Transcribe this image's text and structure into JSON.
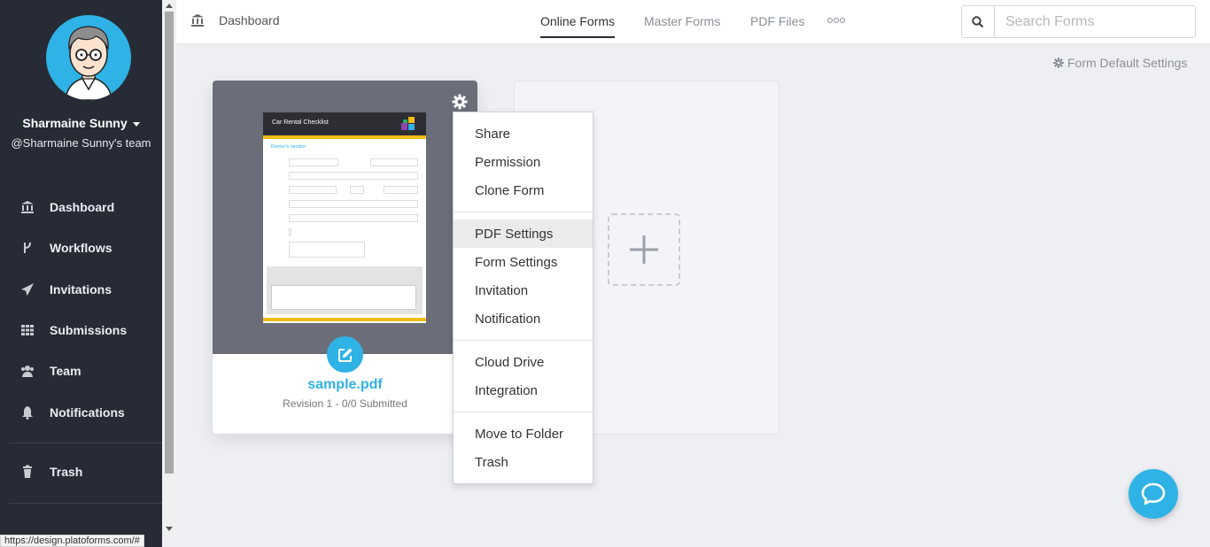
{
  "sidebar": {
    "user_name": "Sharmaine Sunny",
    "team": "@Sharmaine Sunny's team",
    "items": [
      {
        "label": "Dashboard",
        "icon": "bank-icon"
      },
      {
        "label": "Workflows",
        "icon": "branch-icon"
      },
      {
        "label": "Invitations",
        "icon": "paper-plane-icon"
      },
      {
        "label": "Submissions",
        "icon": "grid-icon"
      },
      {
        "label": "Team",
        "icon": "users-icon"
      },
      {
        "label": "Notifications",
        "icon": "bell-icon"
      },
      {
        "label": "Trash",
        "icon": "trash-icon"
      }
    ]
  },
  "status_url": "https://design.platoforms.com/#",
  "header": {
    "breadcrumb": "Dashboard",
    "tabs": [
      {
        "label": "Online Forms",
        "active": true
      },
      {
        "label": "Master Forms",
        "active": false
      },
      {
        "label": "PDF Files",
        "active": false
      }
    ],
    "search": {
      "placeholder": "Search Forms",
      "value": ""
    }
  },
  "form_default_settings": "Form Default Settings",
  "card": {
    "title": "sample.pdf",
    "meta": "Revision 1 - 0/0 Submitted",
    "preview": {
      "title": "Car Rental Checklist",
      "section": "Renter's section"
    }
  },
  "menu": {
    "groups": [
      [
        "Share",
        "Permission",
        "Clone Form"
      ],
      [
        "PDF Settings",
        "Form Settings",
        "Invitation",
        "Notification"
      ],
      [
        "Cloud Drive",
        "Integration"
      ],
      [
        "Move to Folder",
        "Trash"
      ]
    ],
    "highlighted": "PDF Settings"
  },
  "colors": {
    "sidebar_bg": "#262b35",
    "accent": "#2fb2e5",
    "page_bg": "#eeeff3"
  }
}
